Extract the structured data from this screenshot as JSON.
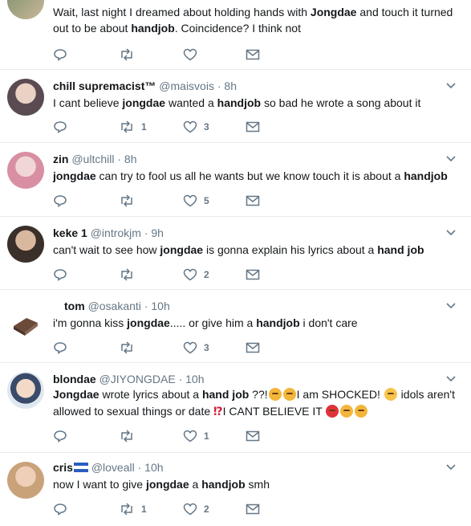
{
  "tweets": [
    {
      "name": "",
      "handle": "",
      "time": "",
      "text_parts": [
        {
          "t": "Wait, last night I dreamed about holding hands with "
        },
        {
          "b": "Jongdae"
        },
        {
          "t": " and touch it turned out to be about "
        },
        {
          "b": "handjob"
        },
        {
          "t": ". Coincidence? I think not"
        }
      ],
      "retweets": "",
      "likes": ""
    },
    {
      "name": "chill supremacist™",
      "handle": "@maisvois",
      "time": "8h",
      "text_parts": [
        {
          "t": "I cant believe "
        },
        {
          "b": "jongdae"
        },
        {
          "t": " wanted a "
        },
        {
          "b": "handjob"
        },
        {
          "t": " so bad he wrote a song about it"
        }
      ],
      "retweets": "1",
      "likes": "3"
    },
    {
      "name": "zin",
      "handle": "@ultchill",
      "time": "8h",
      "text_parts": [
        {
          "b": "jongdae"
        },
        {
          "t": " can try to fool us all he wants but we know touch it is about a "
        },
        {
          "b": "handjob"
        }
      ],
      "retweets": "",
      "likes": "5"
    },
    {
      "name": "keke 1",
      "handle": "@introkjm",
      "time": "9h",
      "text_parts": [
        {
          "t": "can't wait to see how "
        },
        {
          "b": "jongdae"
        },
        {
          "t": " is gonna explain his lyrics about a "
        },
        {
          "b": "hand job"
        }
      ],
      "retweets": "",
      "likes": "2"
    },
    {
      "name": "tom",
      "handle": "@osakanti",
      "time": "10h",
      "text_parts": [
        {
          "t": "i'm gonna kiss "
        },
        {
          "b": "jongdae"
        },
        {
          "t": "..... or give him a "
        },
        {
          "b": "handjob"
        },
        {
          "t": " i don't care"
        }
      ],
      "retweets": "",
      "likes": "3"
    },
    {
      "name": "blondae",
      "handle": "@JIYONGDAE",
      "time": "10h",
      "text_parts": [
        {
          "b": "Jongdae"
        },
        {
          "t": " wrote lyrics about a "
        },
        {
          "b": "hand job"
        },
        {
          "t": " ??!"
        },
        {
          "e": "angry"
        },
        {
          "e": "angry"
        },
        {
          "t": "I am SHOCKED! "
        },
        {
          "e": "flushed"
        },
        {
          "t": " idols aren't allowed to sexual things or date "
        },
        {
          "r": "⁉"
        },
        {
          "t": "I CANT BELIEVE IT "
        },
        {
          "e": "red"
        },
        {
          "e": "angry"
        },
        {
          "e": "angry"
        }
      ],
      "retweets": "",
      "likes": "1"
    },
    {
      "name": "cris",
      "handle": "@loveall",
      "time": "10h",
      "flag": true,
      "text_parts": [
        {
          "t": "now I want to give "
        },
        {
          "b": "jongdae"
        },
        {
          "t": " a "
        },
        {
          "b": "handjob"
        },
        {
          "t": " smh"
        }
      ],
      "retweets": "1",
      "likes": "2"
    }
  ],
  "separator": "·",
  "icons": {
    "reply": "reply-icon",
    "retweet": "retweet-icon",
    "like": "heart-icon",
    "message": "envelope-icon",
    "caret": "chevron-down-icon"
  },
  "colors": {
    "text": "#14171a",
    "muted": "#657786",
    "divider": "#e6ecf0"
  }
}
